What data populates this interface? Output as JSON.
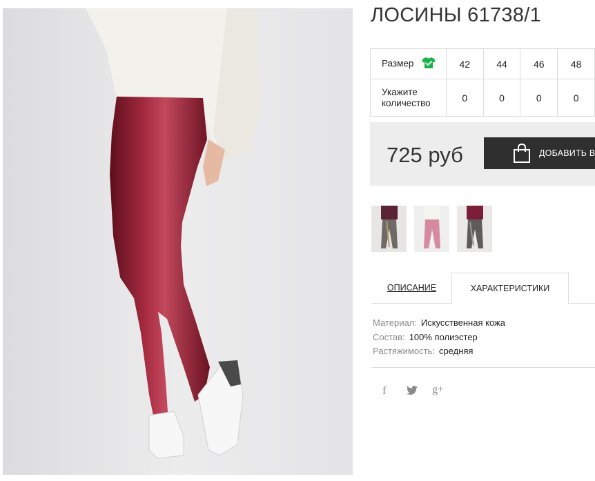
{
  "product": {
    "title": "ЛОСИНЫ 61738/1",
    "price": "725 руб",
    "add_to_cart": "ДОБАВИТЬ В"
  },
  "sizes": {
    "size_label": "Размер",
    "qty_label_1": "Укажите",
    "qty_label_2": "количество",
    "values": [
      "42",
      "44",
      "46",
      "48"
    ],
    "quantities": [
      "0",
      "0",
      "0",
      "0"
    ],
    "accent_color": "#19b34a"
  },
  "tabs": {
    "description": "ОПИСАНИЕ",
    "characteristics": "ХАРАКТЕРИСТИКИ",
    "active": "characteristics"
  },
  "characteristics": [
    {
      "key": "Материал:",
      "value": "Искусственная кожа"
    },
    {
      "key": "Состав:",
      "value": "100% полиэстер"
    },
    {
      "key": "Растяжимость:",
      "value": "средняя"
    }
  ],
  "social": {
    "facebook": "f",
    "twitter": "twitter-icon",
    "google_plus": "g+"
  },
  "colors": {
    "leggings": "#8b1a2c",
    "cart_button": "#2f2f2f",
    "price_box": "#ededed"
  }
}
